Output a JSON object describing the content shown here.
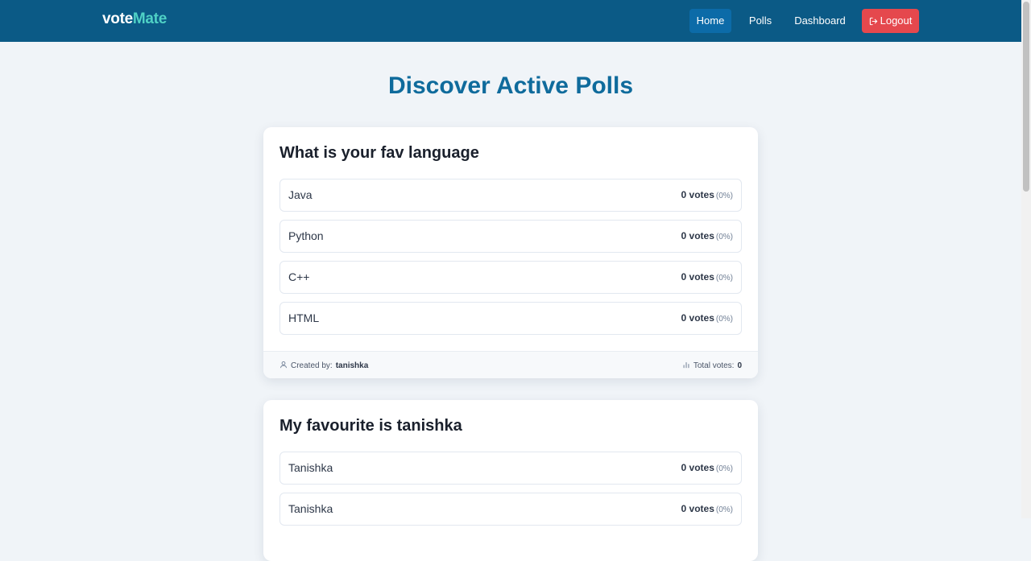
{
  "navbar": {
    "brand_main": "vote",
    "brand_accent": "Mate",
    "links": {
      "home": "Home",
      "polls": "Polls",
      "dashboard": "Dashboard",
      "logout": "Logout"
    },
    "icons": {
      "logout": "logout-icon"
    }
  },
  "page": {
    "title": "Discover Active Polls"
  },
  "polls": [
    {
      "question": "What is your fav language",
      "options": [
        {
          "label": "Java",
          "votes": "0 votes",
          "percent": "(0%)"
        },
        {
          "label": "Python",
          "votes": "0 votes",
          "percent": "(0%)"
        },
        {
          "label": "C++",
          "votes": "0 votes",
          "percent": "(0%)"
        },
        {
          "label": "HTML",
          "votes": "0 votes",
          "percent": "(0%)"
        }
      ],
      "footer": {
        "created_by_label": "Created by:",
        "creator": "tanishka",
        "total_votes_label": "Total votes:",
        "total_votes": "0"
      }
    },
    {
      "question": "My favourite is tanishka",
      "options": [
        {
          "label": "Tanishka",
          "votes": "0 votes",
          "percent": "(0%)"
        },
        {
          "label": "Tanishka",
          "votes": "0 votes",
          "percent": "(0%)"
        }
      ]
    }
  ],
  "colors": {
    "navbar": "#0b5a86",
    "brand_accent": "#4fd1c5",
    "active_nav": "#0c6ba8",
    "logout": "#e5484d",
    "title": "#0f6b9c",
    "background": "#f0f4f8"
  }
}
